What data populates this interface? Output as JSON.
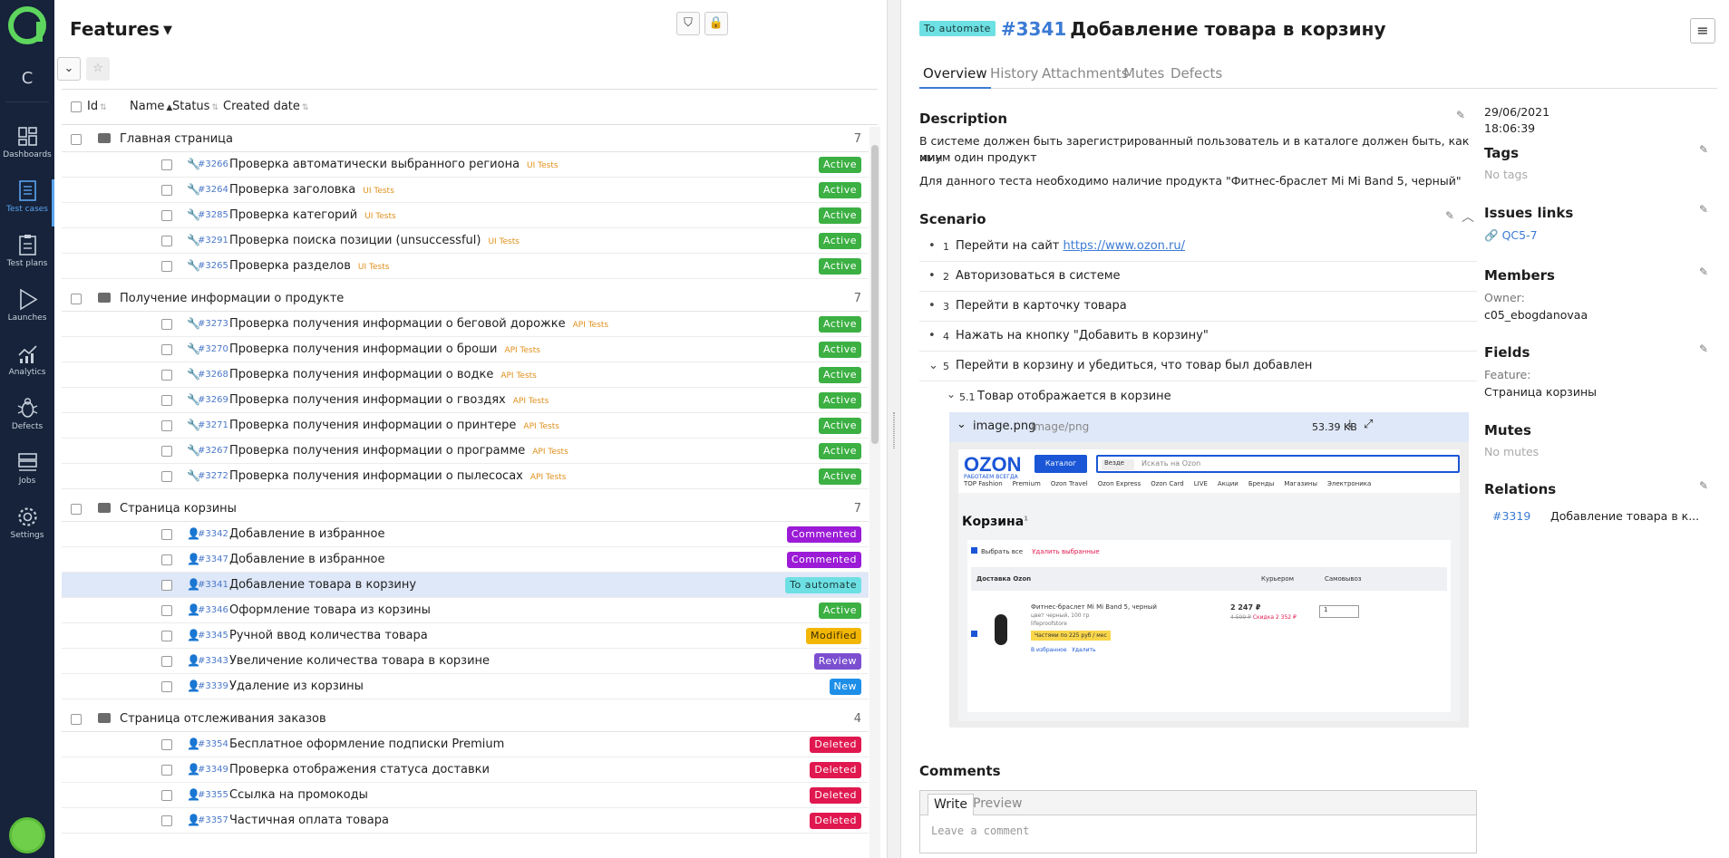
{
  "nav": {
    "project_letter": "C",
    "items": [
      {
        "label": "Dashboards",
        "icon": "dashboards-icon"
      },
      {
        "label": "Test cases",
        "icon": "test-cases-icon"
      },
      {
        "label": "Test plans",
        "icon": "test-plans-icon"
      },
      {
        "label": "Launches",
        "icon": "launches-icon"
      },
      {
        "label": "Analytics",
        "icon": "analytics-icon"
      },
      {
        "label": "Defects",
        "icon": "bug-icon"
      },
      {
        "label": "Jobs",
        "icon": "jobs-icon"
      },
      {
        "label": "Settings",
        "icon": "gear-icon"
      }
    ],
    "active": "Test cases"
  },
  "list": {
    "title": "Features",
    "columns": {
      "id": "Id",
      "name": "Name",
      "status": "Status",
      "created": "Created date"
    },
    "groups": [
      {
        "name": "Главная страница",
        "count": "7",
        "rows": [
          {
            "id": "#3266",
            "name": "Проверка автоматически выбранного региона",
            "tag": "UI Tests",
            "status": "Active",
            "type": "auto"
          },
          {
            "id": "#3264",
            "name": "Проверка заголовка",
            "tag": "UI Tests",
            "status": "Active",
            "type": "auto"
          },
          {
            "id": "#3285",
            "name": "Проверка категорий",
            "tag": "UI Tests",
            "status": "Active",
            "type": "auto"
          },
          {
            "id": "#3291",
            "name": "Проверка поиска позиции (unsuccessful)",
            "tag": "UI Tests",
            "status": "Active",
            "type": "auto"
          },
          {
            "id": "#3265",
            "name": "Проверка разделов",
            "tag": "UI Tests",
            "status": "Active",
            "type": "auto"
          }
        ]
      },
      {
        "name": "Получение информации о продукте",
        "count": "7",
        "rows": [
          {
            "id": "#3273",
            "name": "Проверка получения информации о беговой дорожке",
            "tag": "API Tests",
            "status": "Active",
            "type": "auto"
          },
          {
            "id": "#3270",
            "name": "Проверка получения информации о броши",
            "tag": "API Tests",
            "status": "Active",
            "type": "auto"
          },
          {
            "id": "#3268",
            "name": "Проверка получения информации о водке",
            "tag": "API Tests",
            "status": "Active",
            "type": "auto"
          },
          {
            "id": "#3269",
            "name": "Проверка получения информации о гвоздях",
            "tag": "API Tests",
            "status": "Active",
            "type": "auto"
          },
          {
            "id": "#3271",
            "name": "Проверка получения информации о принтере",
            "tag": "API Tests",
            "status": "Active",
            "type": "auto"
          },
          {
            "id": "#3267",
            "name": "Проверка получения информации о программе",
            "tag": "API Tests",
            "status": "Active",
            "type": "auto"
          },
          {
            "id": "#3272",
            "name": "Проверка получения информации о пылесосах",
            "tag": "API Tests",
            "status": "Active",
            "type": "auto"
          }
        ]
      },
      {
        "name": "Страница корзины",
        "count": "7",
        "rows": [
          {
            "id": "#3342",
            "name": "Добавление в избранное",
            "tag": "",
            "status": "Commented",
            "type": "manual"
          },
          {
            "id": "#3347",
            "name": "Добавление в избранное",
            "tag": "",
            "status": "Commented",
            "type": "manual"
          },
          {
            "id": "#3341",
            "name": "Добавление товара в корзину",
            "tag": "",
            "status": "To automate",
            "type": "manual",
            "selected": true
          },
          {
            "id": "#3346",
            "name": "Оформление товара из корзины",
            "tag": "",
            "status": "Active",
            "type": "manual"
          },
          {
            "id": "#3345",
            "name": "Ручной ввод количества товара",
            "tag": "",
            "status": "Modified",
            "type": "manual"
          },
          {
            "id": "#3343",
            "name": "Увеличение количества товара в корзине",
            "tag": "",
            "status": "Review",
            "type": "manual"
          },
          {
            "id": "#3339",
            "name": "Удаление из корзины",
            "tag": "",
            "status": "New",
            "type": "manual"
          }
        ]
      },
      {
        "name": "Страница отслеживания заказов",
        "count": "4",
        "rows": [
          {
            "id": "#3354",
            "name": "Бесплатное оформление подписки Premium",
            "tag": "",
            "status": "Deleted",
            "type": "manual"
          },
          {
            "id": "#3349",
            "name": "Проверка отображения статуса доставки",
            "tag": "",
            "status": "Deleted",
            "type": "manual"
          },
          {
            "id": "#3355",
            "name": "Ссылка на промокоды",
            "tag": "",
            "status": "Deleted",
            "type": "manual"
          },
          {
            "id": "#3357",
            "name": "Частичная оплата товара",
            "tag": "",
            "status": "Deleted",
            "type": "manual"
          }
        ]
      }
    ]
  },
  "status_colors": {
    "Active": "#3cb043",
    "Commented": "#9b1bd6",
    "To automate": "#6de0e3",
    "Modified": "#f2b705",
    "Review": "#7b4fd0",
    "New": "#1e8fe8",
    "Deleted": "#e0184f"
  },
  "detail": {
    "status": "To automate",
    "id": "#3341",
    "title": "Добавление товара в корзину",
    "tabs": [
      "Overview",
      "History",
      "Attachments",
      "Mutes",
      "Defects"
    ],
    "description_heading": "Description",
    "description": [
      "В системе должен быть зарегистрированный пользователь и в каталоге должен быть, как мин",
      "имум один продукт",
      "Для данного теста необходимо наличие продукта \"Фитнес-браслет Mi Mi Band 5, черный\""
    ],
    "scenario_heading": "Scenario",
    "steps": [
      {
        "num": "1",
        "text": "Перейти на сайт ",
        "link": "https://www.ozon.ru/"
      },
      {
        "num": "2",
        "text": "Авторизоваться в системе"
      },
      {
        "num": "3",
        "text": "Перейти в карточку товара"
      },
      {
        "num": "4",
        "text": "Нажать на кнопку \"Добавить в корзину\""
      },
      {
        "num": "5",
        "text": "Перейти в корзину и убедиться, что товар был добавлен"
      }
    ],
    "substep": {
      "num": "5.1",
      "text": "Товар отображается в корзине"
    },
    "attachment": {
      "name": "image.png",
      "type": "image/png",
      "size": "53.39 KB"
    },
    "shot": {
      "logo": "OZON",
      "logo_sub": "РАБОТАЕМ ВСЕГДА",
      "catalog": "Каталог",
      "where": "Везде",
      "search_ph": "Искать на Ozon",
      "menu": [
        "TOP Fashion",
        "Premium",
        "Ozon Travel",
        "Ozon Express",
        "Ozon Card",
        "LIVE",
        "Акции",
        "Бренды",
        "Магазины",
        "Электроника"
      ],
      "cart_title": "Корзина",
      "cart_count": "1",
      "select_all": "Выбрать все",
      "delete_selected": "Удалить выбранные",
      "delivery": "Доставка Ozon",
      "courier": "Курьером",
      "pickup": "Самовывоз",
      "item_name": "Фитнес-браслет Mi Mi Band 5, черный",
      "item_color": "цвет черный, 100 гр",
      "seller": "lifeproofstore",
      "price": "2 247 ₽",
      "old_price": "4 599 ₽",
      "discount": "Скидка 2 352 ₽",
      "qty": "1",
      "installment": "Частями по 225 руб / мес",
      "favorite": "В избранное",
      "remove": "Удалить"
    },
    "comments_heading": "Comments",
    "comment_tabs": [
      "Write",
      "Preview"
    ],
    "comment_placeholder": "Leave a comment"
  },
  "meta": {
    "date": "29/06/2021",
    "time": "18:06:39",
    "tags_h": "Tags",
    "tags_v": "No tags",
    "issues_h": "Issues links",
    "issue": "QC5-7",
    "members_h": "Members",
    "owner_l": "Owner:",
    "owner_v": "c05_ebogdanovaa",
    "fields_h": "Fields",
    "feature_l": "Feature:",
    "feature_v": "Страница корзины",
    "mutes_h": "Mutes",
    "mutes_v": "No mutes",
    "relations_h": "Relations",
    "rel_id": "#3319",
    "rel_name": "Добавление товара в к..."
  }
}
